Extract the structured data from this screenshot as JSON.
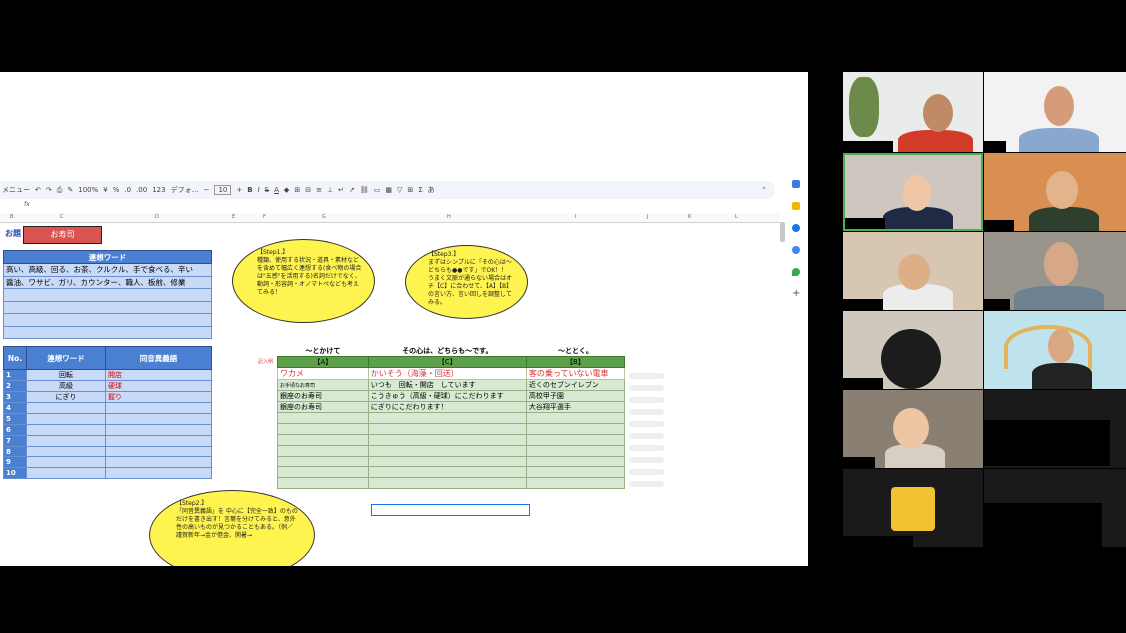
{
  "sheet": {
    "toolbar": {
      "menu_label": "メニュー",
      "zoom": "100%",
      "currency": "¥",
      "percent": "%",
      "decimal_dec": ".0",
      "decimal_inc": ".00",
      "number_fmt": "123",
      "font": "デフォ…",
      "font_size": "10",
      "bold": "B",
      "italic": "I",
      "strike": "S",
      "textcolor": "A",
      "text_a": "あ"
    },
    "formula_bar": "fx",
    "col_headers": [
      "B",
      "C",
      "D",
      "E",
      "F",
      "G",
      "H",
      "I",
      "J",
      "K",
      "L"
    ],
    "odai_label": "お題",
    "odai_value": "お寿司",
    "rensou_table": {
      "header": "連想ワード",
      "rows": [
        "高い、高級、回る、お茶、クルクル、手で食べる、辛い",
        "醤油、ワサビ、ガリ、カウンター、職人、板前、修業",
        "",
        "",
        "",
        ""
      ]
    },
    "douon_table": {
      "headers": [
        "No.",
        "連想ワード",
        "同音異義語"
      ],
      "rows": [
        {
          "no": "1",
          "word": "回転",
          "homonym": "開店"
        },
        {
          "no": "2",
          "word": "高級",
          "homonym": "硬球"
        },
        {
          "no": "3",
          "word": "にぎり",
          "homonym": "握り"
        },
        {
          "no": "4",
          "word": "",
          "homonym": ""
        },
        {
          "no": "5",
          "word": "",
          "homonym": ""
        },
        {
          "no": "6",
          "word": "",
          "homonym": ""
        },
        {
          "no": "7",
          "word": "",
          "homonym": ""
        },
        {
          "no": "8",
          "word": "",
          "homonym": ""
        },
        {
          "no": "9",
          "word": "",
          "homonym": ""
        },
        {
          "no": "10",
          "word": "",
          "homonym": ""
        }
      ]
    },
    "nazo_table": {
      "top": [
        "〜とかけて",
        "その心は、どちらも〜です。",
        "〜ととく。"
      ],
      "headers": [
        "【A】",
        "【C】",
        "【B】"
      ],
      "kinyu_label": "記入例",
      "example": [
        "ワカメ",
        "かいそう（海藻・回送）",
        "客の乗っていない電車"
      ],
      "rows": [
        [
          "お手頃なお寿司",
          "いつも　回転・開店　しています",
          "近くのセブンイレブン"
        ],
        [
          "銀座のお寿司",
          "こうきゅう（高級・硬球）にこだわります",
          "高校甲子園"
        ],
        [
          "銀座のお寿司",
          "にぎりにこだわります！",
          "大谷翔平選手"
        ],
        [
          "",
          "",
          ""
        ],
        [
          "",
          "",
          ""
        ],
        [
          "",
          "",
          ""
        ],
        [
          "",
          "",
          ""
        ],
        [
          "",
          "",
          ""
        ],
        [
          "",
          "",
          ""
        ],
        [
          "",
          "",
          ""
        ]
      ]
    },
    "bubbles": {
      "step1": {
        "title": "【Step1.】",
        "body": "種類、使用する状況・道具・素材などを含めて幅広く連想する(食べ物の場合は\"五感\"を活用する)名詞だけでなく、動詞・形容詞・オノマトペなども考えてみる！"
      },
      "step2": {
        "title": "【Step2.】",
        "body": "「同音異義語」を 中心に【完全一致】のものだけを書き出す！言葉を分けてみると、意外性の高いものが見つかることもある。（例／謹賀新年→金が借金、閑暑→"
      },
      "step3": {
        "title": "【Step3.】",
        "body": "まずはシンプルに「その心は〜どちらも●●です」でOK！！うまく文脈が通らない場合はオチ【C】に合わせて、【A】【B】の言い方、言い回しを調整してみる。"
      }
    }
  },
  "participants_count": 12,
  "colors": {
    "blue_header": "#4a7fd1",
    "blue_cell": "#c9daf8",
    "green_header": "#5ea04a",
    "green_cell": "#d9ead3",
    "bubble": "#fff44f",
    "odai_red": "#d9534f"
  }
}
